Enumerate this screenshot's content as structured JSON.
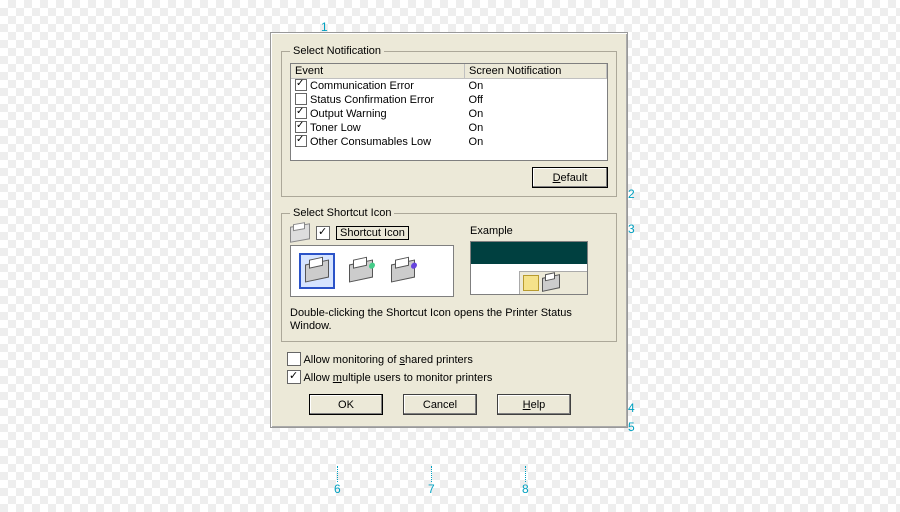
{
  "callouts": [
    "1",
    "2",
    "3",
    "4",
    "5",
    "6",
    "7",
    "8"
  ],
  "notification": {
    "legend": "Select Notification",
    "headers": {
      "event": "Event",
      "screen": "Screen Notification"
    },
    "rows": [
      {
        "checked": true,
        "event": "Communication Error",
        "screen": "On"
      },
      {
        "checked": false,
        "event": "Status Confirmation Error",
        "screen": "Off"
      },
      {
        "checked": true,
        "event": "Output Warning",
        "screen": "On"
      },
      {
        "checked": true,
        "event": "Toner Low",
        "screen": "On"
      },
      {
        "checked": true,
        "event": "Other Consumables Low",
        "screen": "On"
      }
    ],
    "default_pre": "D",
    "default_rest": "efault"
  },
  "shortcut": {
    "legend": "Select Shortcut Icon",
    "checkbox_label": "Shortcut Icon",
    "checkbox_checked": true,
    "example_label": "Example",
    "hint": "Double-clicking the Shortcut Icon opens the Printer Status Window."
  },
  "options": {
    "shared": {
      "checked": false,
      "pre": "Allow monitoring of ",
      "u": "s",
      "post": "hared printers"
    },
    "multiple": {
      "checked": true,
      "pre": "Allow ",
      "u": "m",
      "post": "ultiple users to monitor printers"
    }
  },
  "buttons": {
    "ok": "OK",
    "cancel": "Cancel",
    "help_u": "H",
    "help_rest": "elp"
  }
}
